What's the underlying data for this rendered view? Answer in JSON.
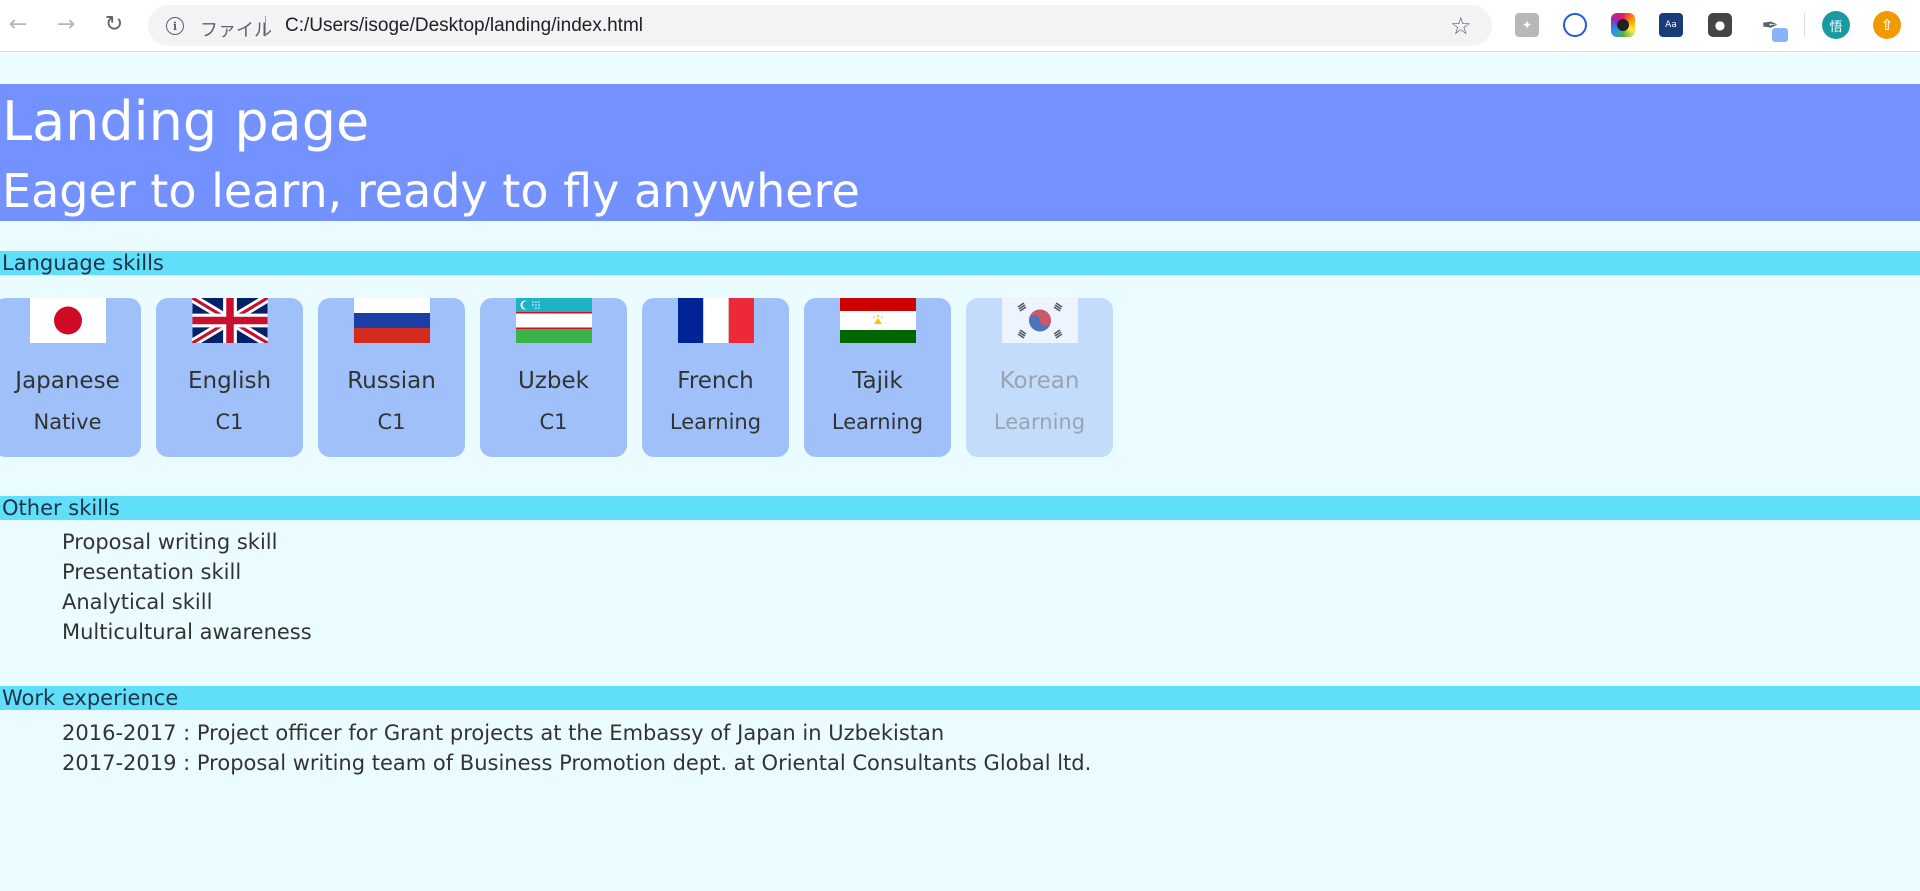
{
  "browser": {
    "address_label": "ファイル",
    "url": "C:/Users/isoge/Desktop/landing/index.html",
    "avatar_label": "悟",
    "dict_label": "Aa"
  },
  "hero": {
    "title": "Landing page",
    "subtitle": "Eager to learn, ready to fly anywhere"
  },
  "sections": {
    "language": "Language skills",
    "other": "Other skills",
    "work": "Work experience"
  },
  "languages": [
    {
      "name": "Japanese",
      "level": "Native",
      "flag": "japan-flag-icon"
    },
    {
      "name": "English",
      "level": "C1",
      "flag": "uk-flag-icon"
    },
    {
      "name": "Russian",
      "level": "C1",
      "flag": "russia-flag-icon"
    },
    {
      "name": "Uzbek",
      "level": "C1",
      "flag": "uzbekistan-flag-icon"
    },
    {
      "name": "French",
      "level": "Learning",
      "flag": "france-flag-icon"
    },
    {
      "name": "Tajik",
      "level": "Learning",
      "flag": "tajikistan-flag-icon"
    },
    {
      "name": "Korean",
      "level": "Learning",
      "flag": "korea-flag-icon"
    }
  ],
  "other_skills": [
    "Proposal writing skill",
    "Presentation skill",
    "Analytical skill",
    "Multicultural awareness"
  ],
  "work_experience": [
    "2016-2017 : Project officer for Grant projects at the Embassy of Japan in Uzbekistan",
    "2017-2019 : Proposal writing team of Business Promotion dept. at Oriental Consultants Global ltd."
  ],
  "colors": {
    "hero": "#7492ff",
    "section_bar": "#60dffa",
    "page_bg": "#eafcff",
    "card": "#9fc0f8"
  }
}
